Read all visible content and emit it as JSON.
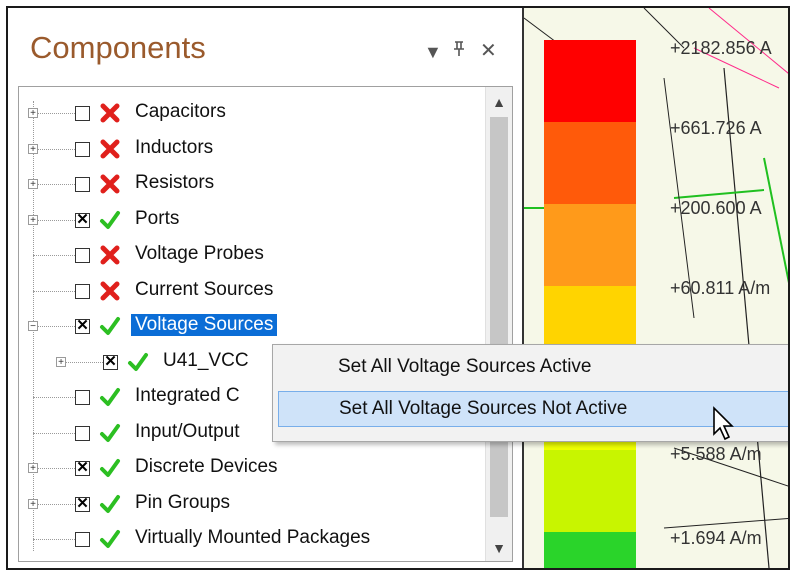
{
  "panel": {
    "title": "Components",
    "controls": {
      "dropdown": "▾",
      "pin": "ᵖ",
      "close": "✕"
    }
  },
  "tree": {
    "items": [
      {
        "label": "Capacitors",
        "checked": false,
        "active": false,
        "expander": true
      },
      {
        "label": "Inductors",
        "checked": false,
        "active": false,
        "expander": true
      },
      {
        "label": "Resistors",
        "checked": false,
        "active": false,
        "expander": true
      },
      {
        "label": "Ports",
        "checked": true,
        "active": true,
        "expander": true
      },
      {
        "label": "Voltage Probes",
        "checked": false,
        "active": false,
        "expander": false
      },
      {
        "label": "Current Sources",
        "checked": false,
        "active": false,
        "expander": false
      },
      {
        "label": "Voltage Sources",
        "checked": true,
        "active": true,
        "expander": true,
        "selected": true
      },
      {
        "label": "U41_VCC",
        "checked": true,
        "active": true,
        "expander": true
      },
      {
        "label": "Integrated C",
        "checked": false,
        "active": true,
        "expander": false
      },
      {
        "label": "Input/Output",
        "checked": false,
        "active": true,
        "expander": false
      },
      {
        "label": "Discrete Devices",
        "checked": true,
        "active": true,
        "expander": true
      },
      {
        "label": "Pin Groups",
        "checked": true,
        "active": true,
        "expander": true
      },
      {
        "label": "Virtually Mounted Packages",
        "checked": false,
        "active": true,
        "expander": false
      }
    ]
  },
  "context_menu": {
    "items": [
      {
        "label": "Set All Voltage Sources Active"
      },
      {
        "label": "Set All Voltage Sources Not Active",
        "hover": true
      }
    ]
  },
  "legend": {
    "values": [
      "+2182.856 A",
      "+661.726 A",
      "+200.600 A",
      "+60.811 A/m",
      "+5.588 A/m",
      "+1.694 A/m"
    ],
    "colors": [
      "#ff0000",
      "#ff5a0a",
      "#ff9a1a",
      "#ffd400",
      "#eeff00",
      "#c8f500",
      "#6ee21c",
      "#2ad42a"
    ]
  }
}
